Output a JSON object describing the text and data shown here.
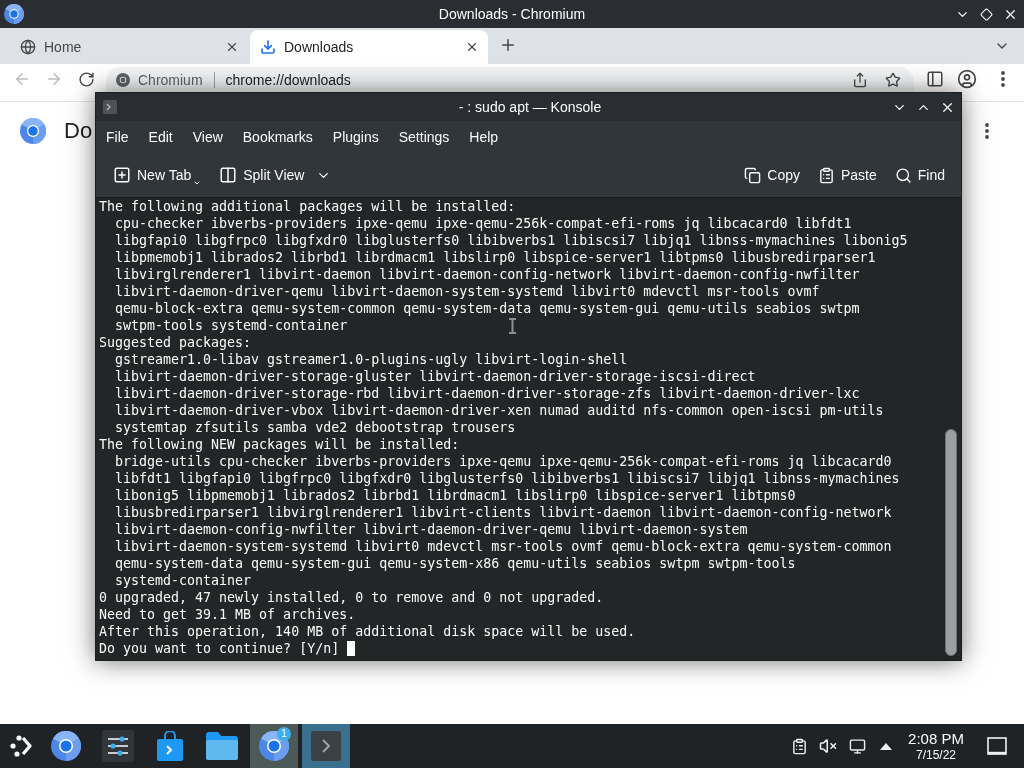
{
  "chromium": {
    "title": "Downloads - Chromium",
    "tabs": [
      {
        "label": "Home",
        "selected": false
      },
      {
        "label": "Downloads",
        "selected": true
      }
    ],
    "nav": [
      {
        "disabled": true
      },
      {
        "disabled": true
      },
      {
        "disabled": false
      }
    ],
    "omnibox": {
      "chip": "Chromium",
      "url": "chrome://downloads"
    },
    "page": {
      "heading": "Do"
    }
  },
  "konsole": {
    "title": "- : sudo apt — Konsole",
    "menu": [
      "File",
      "Edit",
      "View",
      "Bookmarks",
      "Plugins",
      "Settings",
      "Help"
    ],
    "toolbar_left": [
      {
        "label": "New Tab"
      },
      {
        "label": "Split View"
      }
    ],
    "toolbar_right": [
      {
        "label": "Copy"
      },
      {
        "label": "Paste"
      },
      {
        "label": "Find"
      }
    ],
    "terminal": {
      "lines": [
        {
          "text": "The following additional packages will be installed:",
          "children": [
            {
              "text": "cpu-checker ibverbs-providers ipxe-qemu ipxe-qemu-256k-compat-efi-roms jq libcacard0 libfdt1"
            },
            {
              "text": "libgfapi0 libgfrpc0 libgfxdr0 libglusterfs0 libibverbs1 libiscsi7 libjq1 libnss-mymachines libonig5"
            },
            {
              "text": "libpmemobj1 librados2 librbd1 librdmacm1 libslirp0 libspice-server1 libtpms0 libusbredirparser1"
            },
            {
              "text": "libvirglrenderer1 libvirt-daemon libvirt-daemon-config-network libvirt-daemon-config-nwfilter"
            },
            {
              "text": "libvirt-daemon-driver-qemu libvirt-daemon-system-systemd libvirt0 mdevctl msr-tools ovmf"
            },
            {
              "text": "qemu-block-extra qemu-system-common qemu-system-data qemu-system-gui qemu-utils seabios swtpm"
            },
            {
              "text": "swtpm-tools systemd-container"
            }
          ]
        },
        {
          "text": "Suggested packages:",
          "children": [
            {
              "text": "gstreamer1.0-libav gstreamer1.0-plugins-ugly libvirt-login-shell"
            },
            {
              "text": "libvirt-daemon-driver-storage-gluster libvirt-daemon-driver-storage-iscsi-direct"
            },
            {
              "text": "libvirt-daemon-driver-storage-rbd libvirt-daemon-driver-storage-zfs libvirt-daemon-driver-lxc"
            },
            {
              "text": "libvirt-daemon-driver-vbox libvirt-daemon-driver-xen numad auditd nfs-common open-iscsi pm-utils"
            },
            {
              "text": "systemtap zfsutils samba vde2 debootstrap trousers"
            }
          ]
        },
        {
          "text": "The following NEW packages will be installed:",
          "children": [
            {
              "text": "bridge-utils cpu-checker ibverbs-providers ipxe-qemu ipxe-qemu-256k-compat-efi-roms jq libcacard0"
            },
            {
              "text": "libfdt1 libgfapi0 libgfrpc0 libgfxdr0 libglusterfs0 libibverbs1 libiscsi7 libjq1 libnss-mymachines"
            },
            {
              "text": "libonig5 libpmemobj1 librados2 librbd1 librdmacm1 libslirp0 libspice-server1 libtpms0"
            },
            {
              "text": "libusbredirparser1 libvirglrenderer1 libvirt-clients libvirt-daemon libvirt-daemon-config-network"
            },
            {
              "text": "libvirt-daemon-config-nwfilter libvirt-daemon-driver-qemu libvirt-daemon-system"
            },
            {
              "text": "libvirt-daemon-system-systemd libvirt0 mdevctl msr-tools ovmf qemu-block-extra qemu-system-common"
            },
            {
              "text": "qemu-system-data qemu-system-gui qemu-system-x86 qemu-utils seabios swtpm swtpm-tools"
            },
            {
              "text": "systemd-container"
            }
          ]
        },
        {
          "text": "0 upgraded, 47 newly installed, 0 to remove and 0 not upgraded."
        },
        {
          "text": "Need to get 39.1 MB of archives."
        },
        {
          "text": "After this operation, 140 MB of additional disk space will be used."
        }
      ],
      "prompt": "Do you want to continue? [Y/n]"
    }
  },
  "taskbar": {
    "tasks": [
      {
        "running": false,
        "active": false
      },
      {
        "running": false,
        "active": false
      },
      {
        "running": false,
        "active": false
      },
      {
        "running": false,
        "active": false
      },
      {
        "running": true,
        "active": false,
        "badge": "1"
      },
      {
        "running": true,
        "active": true
      }
    ],
    "clock": {
      "time": "2:08 PM",
      "date": "7/15/22"
    }
  }
}
